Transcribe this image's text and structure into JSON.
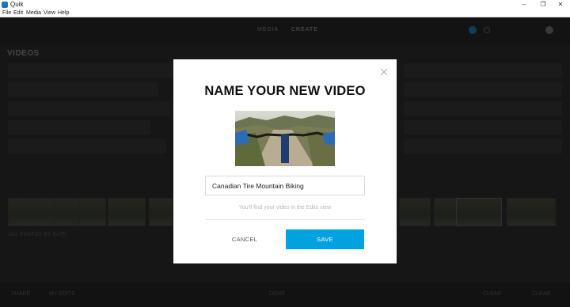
{
  "window": {
    "title": "Quik",
    "minimize_glyph": "–",
    "maximize_glyph": "❐",
    "close_glyph": "✕"
  },
  "menu": [
    "File",
    "Edit",
    "Media",
    "View",
    "Help"
  ],
  "background": {
    "tabs": [
      "MEDIA",
      "CREATE"
    ],
    "section_title": "VIDEOS",
    "filmstrip_label": "ALL PHOTOS BY DATE",
    "bottom_items": [
      "SHARE",
      "MY EDITS",
      "DONE",
      "CLEAR",
      "CLEAR"
    ]
  },
  "modal": {
    "close_glyph": "✕",
    "title": "NAME YOUR NEW VIDEO",
    "input_value": "Canadian Tire Mountain Biking",
    "helper_text": "You'll find your video in the Edits view",
    "cancel_label": "CANCEL",
    "save_label": "SAVE"
  },
  "colors": {
    "accent": "#00a3e0",
    "app_background": "#222222",
    "modal_background": "#ffffff"
  }
}
